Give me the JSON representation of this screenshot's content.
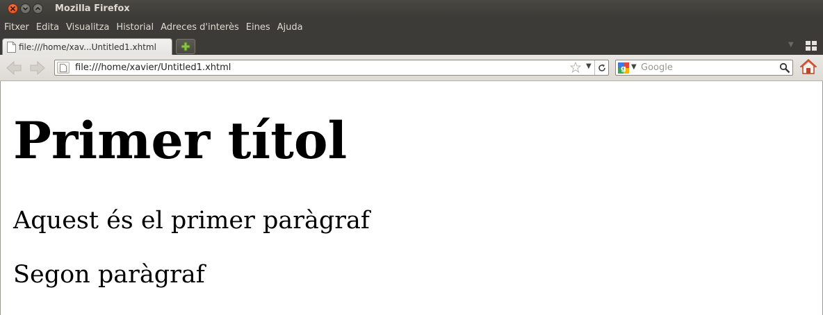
{
  "window": {
    "title": "Mozilla Firefox",
    "controls": [
      "close-icon",
      "minimize-icon",
      "maximize-icon"
    ]
  },
  "menubar": {
    "items": [
      {
        "label": "Fitxer"
      },
      {
        "label": "Edita"
      },
      {
        "label": "Visualitza"
      },
      {
        "label": "Historial"
      },
      {
        "label": "Adreces d'interès"
      },
      {
        "label": "Eines"
      },
      {
        "label": "Ajuda"
      }
    ]
  },
  "tabs": [
    {
      "label": "file:///home/xav...Untitled1.xhtml",
      "active": true
    }
  ],
  "navbar": {
    "url": "file:///home/xavier/Untitled1.xhtml",
    "search_placeholder": "Google"
  },
  "page": {
    "heading": "Primer títol",
    "paragraphs": [
      "Aquest és el primer paràgraf",
      "Segon paràgraf"
    ]
  },
  "colors": {
    "titlebar": "#3c3b37",
    "menu_text": "#dfdbd2",
    "close_button": "#e4572a",
    "newtab_plus": "#8bc34a"
  }
}
